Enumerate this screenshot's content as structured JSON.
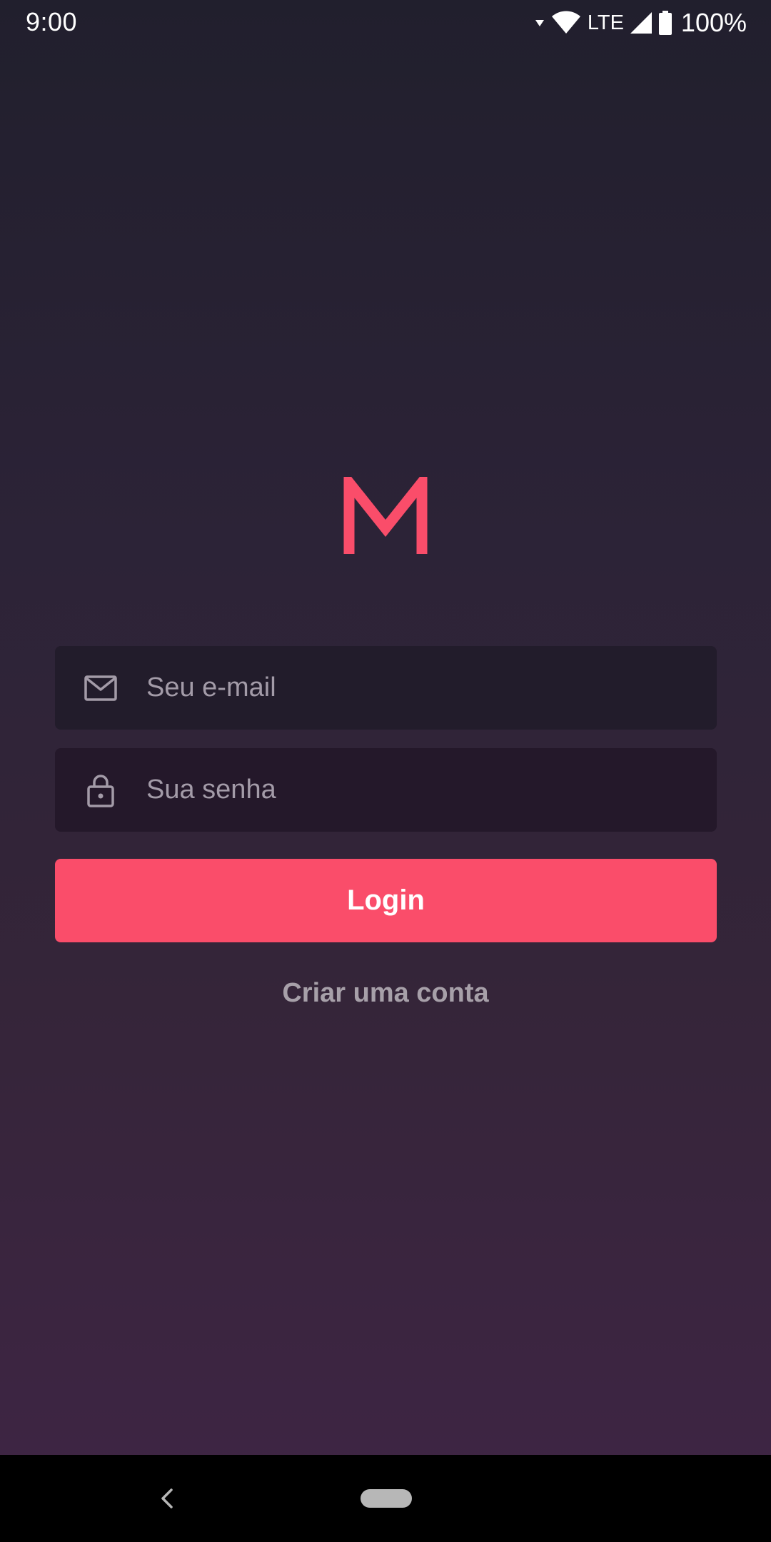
{
  "status_bar": {
    "time": "9:00",
    "network": "LTE",
    "battery": "100%",
    "icons": [
      "data-arrow-icon",
      "wifi-icon",
      "cell-signal-icon",
      "battery-icon"
    ]
  },
  "logo": {
    "letter": "M",
    "color": "#fa4d6a"
  },
  "form": {
    "email_placeholder": "Seu e-mail",
    "email_value": "",
    "email_icon": "mail-icon",
    "password_placeholder": "Sua senha",
    "password_value": "",
    "password_icon": "lock-icon"
  },
  "actions": {
    "login_label": "Login",
    "create_account_label": "Criar uma conta"
  },
  "colors": {
    "accent": "#fa4d6a",
    "field_bg": "#221c2b",
    "secondary_text": "#a7a0a9"
  },
  "nav": {
    "icons": [
      "back-icon",
      "home-pill"
    ]
  }
}
